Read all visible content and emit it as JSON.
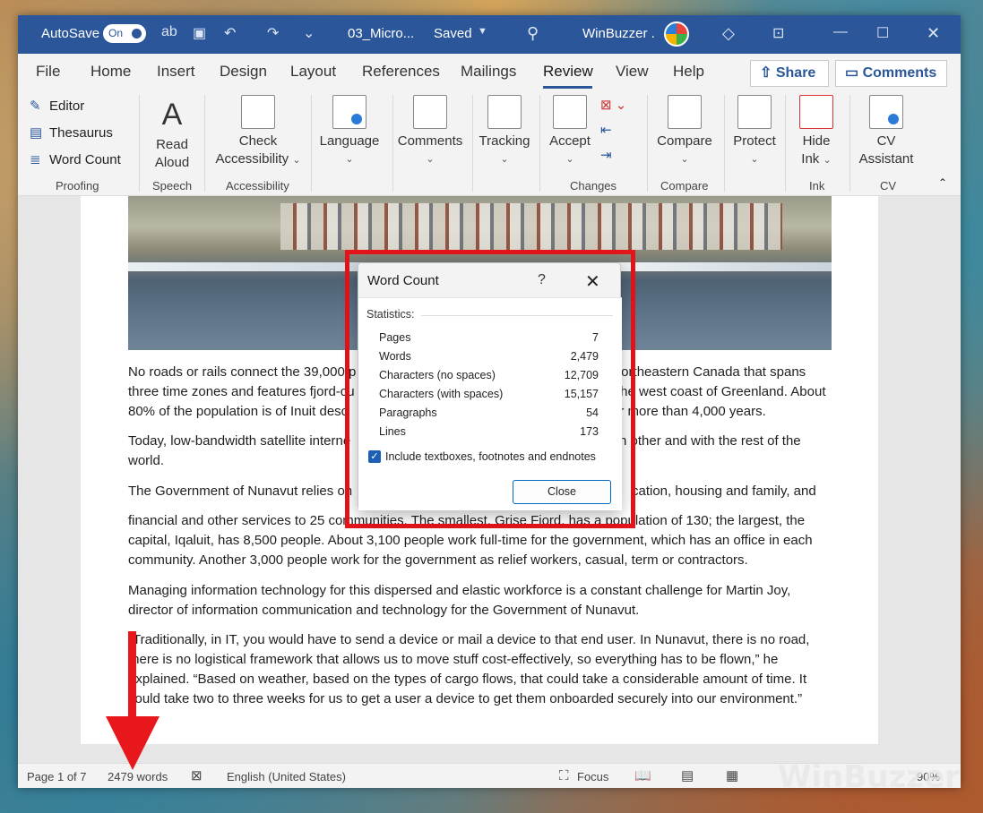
{
  "titlebar": {
    "autosave_label": "AutoSave",
    "autosave_state": "On",
    "filename": "03_Micro...",
    "save_status": "Saved",
    "user": "WinBuzzer ."
  },
  "tabs": [
    "File",
    "Home",
    "Insert",
    "Design",
    "Layout",
    "References",
    "Mailings",
    "Review",
    "View",
    "Help"
  ],
  "active_tab": "Review",
  "share_label": "Share",
  "comments_label": "Comments",
  "ribbon": {
    "proofing": {
      "editor": "Editor",
      "thesaurus": "Thesaurus",
      "word_count": "Word Count",
      "label": "Proofing"
    },
    "speech": {
      "read_aloud_1": "Read",
      "read_aloud_2": "Aloud",
      "label": "Speech"
    },
    "accessibility": {
      "check_1": "Check",
      "check_2": "Accessibility",
      "label": "Accessibility"
    },
    "language": "Language",
    "comments": "Comments",
    "tracking": "Tracking",
    "changes": {
      "accept": "Accept",
      "label": "Changes"
    },
    "compare": {
      "compare": "Compare",
      "label": "Compare"
    },
    "protect": "Protect",
    "ink": {
      "hide_1": "Hide",
      "hide_2": "Ink",
      "label": "Ink"
    },
    "cv": {
      "cv_1": "CV",
      "cv_2": "Assistant",
      "label": "CV"
    }
  },
  "document": {
    "p1_l1": "No roads or rails connect the 39,000 p",
    "p1_l1b": "in northeastern Canada that spans",
    "p1_l2": "three time zones and features fjord-cu",
    "p1_l2b": "the west coast of Greenland. About",
    "p1_l3": "80% of the population is of Inuit desc",
    "p1_l3b": "or more than 4,000 years.",
    "p2_l1": "Today, low-bandwidth satellite interne",
    "p2_l1b": "h other and with the rest of the",
    "p2_l2": "world.",
    "p3_l1": "The Government of Nunavut relies on",
    "p3_l1b": "cation, housing and family, and",
    "p4_l1": "financial and other services to 25 communities. The smallest, Grise Fiord, has a population of 130; the largest, the",
    "p4_l2": "capital, Iqaluit, has 8,500 people. About 3,100 people work full-time for the government, which has an office in each",
    "p4_l3": "community. Another 3,000 people work for the government as relief workers, casual, term or contractors.",
    "p5_l1": "Managing information technology for this dispersed and elastic workforce is a constant challenge for Martin Joy,",
    "p5_l2": "director of information communication and technology for the Government of Nunavut.",
    "p6_l1": "“Traditionally, in IT, you would have to send a device or mail a device to that end user. In Nunavut, there is no road,",
    "p6_l2": "there is no logistical framework that allows us to move stuff cost-effectively, so everything has to be flown,” he",
    "p6_l3": "explained. “Based on weather, based on the types of cargo flows, that could take a considerable amount of time. It",
    "p6_l4": "could take two to three weeks for us to get a user a device to get them onboarded securely into our environment.”"
  },
  "dialog": {
    "title": "Word Count",
    "help": "?",
    "section": "Statistics:",
    "stats": [
      {
        "label": "Pages",
        "value": "7"
      },
      {
        "label": "Words",
        "value": "2,479"
      },
      {
        "label": "Characters (no spaces)",
        "value": "12,709"
      },
      {
        "label": "Characters (with spaces)",
        "value": "15,157"
      },
      {
        "label": "Paragraphs",
        "value": "54"
      },
      {
        "label": "Lines",
        "value": "173"
      }
    ],
    "checkbox_label": "Include textboxes, footnotes and endnotes",
    "close_label": "Close"
  },
  "statusbar": {
    "page": "Page 1 of 7",
    "words": "2479 words",
    "language": "English (United States)",
    "focus": "Focus",
    "zoom": "90%"
  },
  "watermark": "WinBuzzer"
}
